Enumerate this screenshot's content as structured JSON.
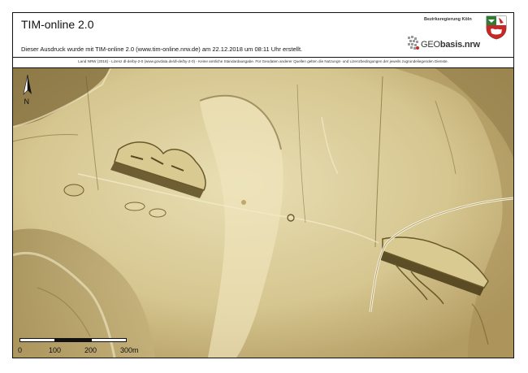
{
  "header": {
    "title": "TIM-online 2.0",
    "subtitle": "Dieser Ausdruck wurde mit TIM-online 2.0 (www.tim-online.nrw.de) am 22.12.2018 um 08:11 Uhr erstellt.",
    "organization": "Bezirksregierung Köln",
    "logo_geo": "GEO",
    "logo_basis": "basis.nrw",
    "crest_icon": "nrw-coat-of-arms-icon"
  },
  "license_text": "Land NRW (2018) - Lizenz dl-de/by-2-0 (www.govdata.de/dl-de/by-2-0) - Keine amtliche Standardausgabe. Für Geodaten anderer Quellen gelten die Nutzungs- und Lizenzbedingungen der jeweils zugrundeliegenden Dienste.",
  "map": {
    "north_label": "N",
    "north_icon": "north-arrow-icon",
    "scale_labels": [
      "0",
      "100",
      "200",
      "300m"
    ],
    "colors": {
      "terrain": "#c9b47e",
      "shadow": "#6e5a2c",
      "highlight": "#f1e8c4"
    }
  }
}
